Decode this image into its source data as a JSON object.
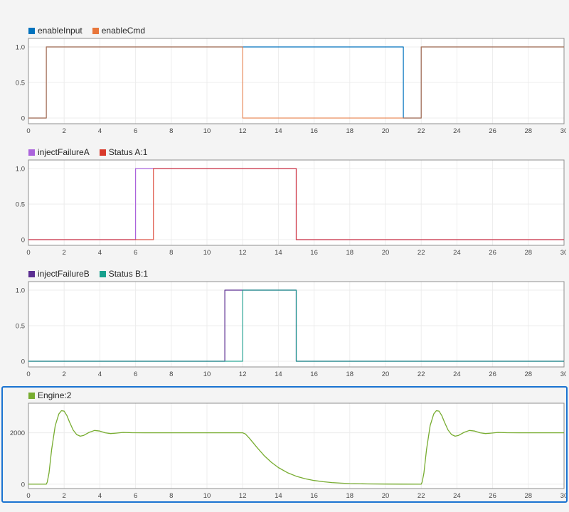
{
  "app": {
    "background": "#f4f4f4",
    "selection_border_color": "#1a73d1",
    "plot_border_color": "#8f8f8f",
    "grid_color": "#ececec"
  },
  "chart_data": [
    {
      "id": "enable-signals",
      "type": "step",
      "title": "",
      "legend": [
        {
          "label": "enableInput",
          "color": "#0072BD"
        },
        {
          "label": "enableCmd",
          "color": "#E8763B"
        }
      ],
      "xlim": [
        0,
        30
      ],
      "xticks": [
        0,
        2,
        4,
        6,
        8,
        10,
        12,
        14,
        16,
        18,
        20,
        22,
        24,
        26,
        28,
        30
      ],
      "ylim": [
        -0.08,
        1.12
      ],
      "yticks": [
        {
          "value": 1,
          "label": "1.0"
        },
        {
          "value": 0.5,
          "label": "0.5"
        },
        {
          "value": 0,
          "label": "0"
        }
      ],
      "grid": true,
      "selected": false,
      "series": [
        {
          "name": "enableInput",
          "color": "#0072BD",
          "width": 1.2,
          "opacity": 1,
          "steps": [
            [
              0,
              0
            ],
            [
              1,
              1
            ],
            [
              21,
              0
            ],
            [
              22,
              1
            ]
          ]
        },
        {
          "name": "enableCmd",
          "color": "#E8763B",
          "width": 1.2,
          "opacity": 0.8,
          "steps": [
            [
              0,
              0
            ],
            [
              1,
              1
            ],
            [
              12,
              0
            ],
            [
              22,
              1
            ]
          ]
        }
      ]
    },
    {
      "id": "failure-a-signals",
      "type": "step",
      "title": "",
      "legend": [
        {
          "label": "injectFailureA",
          "color": "#AB63DC"
        },
        {
          "label": "Status A:1",
          "color": "#D93A2B"
        }
      ],
      "xlim": [
        0,
        30
      ],
      "xticks": [
        0,
        2,
        4,
        6,
        8,
        10,
        12,
        14,
        16,
        18,
        20,
        22,
        24,
        26,
        28,
        30
      ],
      "ylim": [
        -0.08,
        1.12
      ],
      "yticks": [
        {
          "value": 1,
          "label": "1.0"
        },
        {
          "value": 0.5,
          "label": "0.5"
        },
        {
          "value": 0,
          "label": "0"
        }
      ],
      "grid": true,
      "selected": false,
      "series": [
        {
          "name": "injectFailureA",
          "color": "#AB63DC",
          "width": 1.2,
          "opacity": 1,
          "steps": [
            [
              0,
              0
            ],
            [
              6,
              1
            ],
            [
              15,
              0
            ]
          ]
        },
        {
          "name": "Status A:1",
          "color": "#D93A2B",
          "width": 1.2,
          "opacity": 0.85,
          "steps": [
            [
              0,
              0
            ],
            [
              7,
              1
            ],
            [
              15,
              0
            ]
          ]
        }
      ]
    },
    {
      "id": "failure-b-signals",
      "type": "step",
      "title": "",
      "legend": [
        {
          "label": "injectFailureB",
          "color": "#5B2E91"
        },
        {
          "label": "Status B:1",
          "color": "#17A08D"
        }
      ],
      "xlim": [
        0,
        30
      ],
      "xticks": [
        0,
        2,
        4,
        6,
        8,
        10,
        12,
        14,
        16,
        18,
        20,
        22,
        24,
        26,
        28,
        30
      ],
      "ylim": [
        -0.08,
        1.12
      ],
      "yticks": [
        {
          "value": 1,
          "label": "1.0"
        },
        {
          "value": 0.5,
          "label": "0.5"
        },
        {
          "value": 0,
          "label": "0"
        }
      ],
      "grid": true,
      "selected": false,
      "series": [
        {
          "name": "injectFailureB",
          "color": "#5B2E91",
          "width": 1.2,
          "opacity": 1,
          "steps": [
            [
              0,
              0
            ],
            [
              11,
              1
            ],
            [
              15,
              0
            ]
          ]
        },
        {
          "name": "Status B:1",
          "color": "#17A08D",
          "width": 1.2,
          "opacity": 0.9,
          "steps": [
            [
              0,
              0
            ],
            [
              12,
              1
            ],
            [
              15,
              0
            ]
          ]
        }
      ]
    },
    {
      "id": "engine-speed",
      "type": "line",
      "title": "",
      "legend": [
        {
          "label": "Engine:2",
          "color": "#77AC30"
        }
      ],
      "xlim": [
        0,
        30
      ],
      "xticks": [
        0,
        2,
        4,
        6,
        8,
        10,
        12,
        14,
        16,
        18,
        20,
        22,
        24,
        26,
        28,
        30
      ],
      "ylim": [
        -170,
        3150
      ],
      "yticks": [
        {
          "value": 2000,
          "label": "2000"
        },
        {
          "value": 0,
          "label": "0"
        }
      ],
      "grid": true,
      "selected": true,
      "series": [
        {
          "name": "Engine:2",
          "color": "#77AC30",
          "width": 1.3,
          "opacity": 1,
          "points": [
            [
              0,
              0
            ],
            [
              1,
              0
            ],
            [
              1.05,
              80
            ],
            [
              1.15,
              430
            ],
            [
              1.3,
              1350
            ],
            [
              1.5,
              2280
            ],
            [
              1.7,
              2730
            ],
            [
              1.85,
              2860
            ],
            [
              2,
              2840
            ],
            [
              2.15,
              2670
            ],
            [
              2.3,
              2420
            ],
            [
              2.5,
              2110
            ],
            [
              2.7,
              1930
            ],
            [
              2.9,
              1865
            ],
            [
              3.1,
              1900
            ],
            [
              3.4,
              2015
            ],
            [
              3.7,
              2090
            ],
            [
              4,
              2065
            ],
            [
              4.3,
              2000
            ],
            [
              4.6,
              1968
            ],
            [
              4.9,
              1985
            ],
            [
              5.3,
              2012
            ],
            [
              5.8,
              2003
            ],
            [
              6.5,
              1998
            ],
            [
              12,
              2000
            ],
            [
              12.15,
              1955
            ],
            [
              12.4,
              1770
            ],
            [
              12.8,
              1430
            ],
            [
              13.2,
              1115
            ],
            [
              13.6,
              855
            ],
            [
              14,
              645
            ],
            [
              14.5,
              450
            ],
            [
              15,
              310
            ],
            [
              15.5,
              212
            ],
            [
              16,
              142
            ],
            [
              16.5,
              95
            ],
            [
              17,
              62
            ],
            [
              17.5,
              40
            ],
            [
              18,
              25
            ],
            [
              19,
              10
            ],
            [
              20,
              4
            ],
            [
              21,
              1
            ],
            [
              22,
              0
            ],
            [
              22.05,
              80
            ],
            [
              22.15,
              430
            ],
            [
              22.3,
              1350
            ],
            [
              22.5,
              2280
            ],
            [
              22.7,
              2730
            ],
            [
              22.85,
              2860
            ],
            [
              23,
              2840
            ],
            [
              23.15,
              2670
            ],
            [
              23.3,
              2420
            ],
            [
              23.5,
              2110
            ],
            [
              23.7,
              1930
            ],
            [
              23.9,
              1865
            ],
            [
              24.1,
              1900
            ],
            [
              24.4,
              2015
            ],
            [
              24.7,
              2090
            ],
            [
              25,
              2065
            ],
            [
              25.3,
              2000
            ],
            [
              25.6,
              1968
            ],
            [
              25.9,
              1985
            ],
            [
              26.3,
              2012
            ],
            [
              26.8,
              2003
            ],
            [
              27.5,
              1998
            ],
            [
              30,
              2000
            ]
          ]
        }
      ]
    }
  ]
}
